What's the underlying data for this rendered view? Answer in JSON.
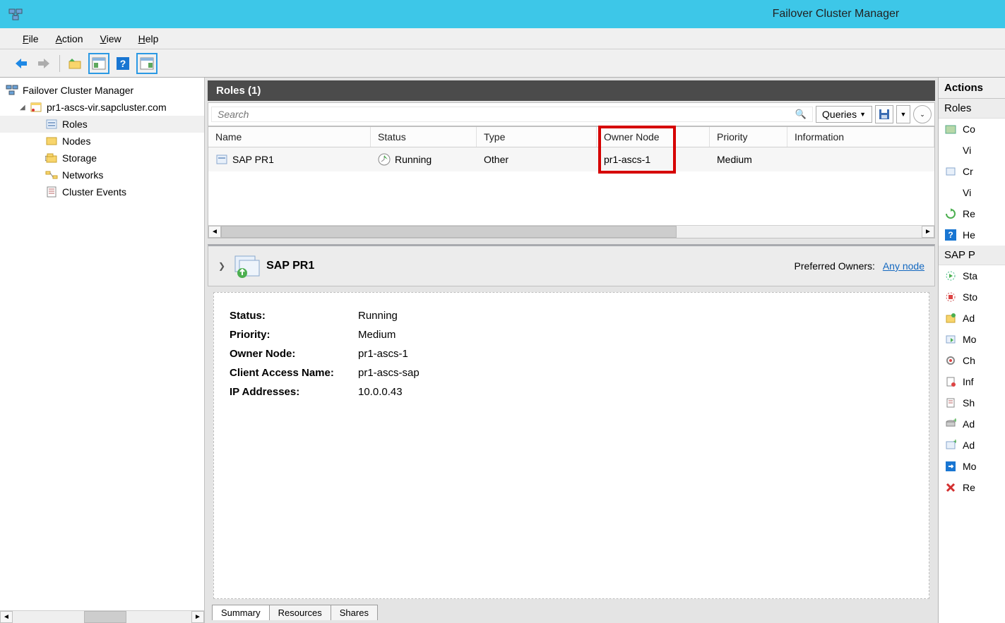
{
  "window": {
    "title": "Failover Cluster Manager"
  },
  "menu": {
    "file": "File",
    "action": "Action",
    "view": "View",
    "help": "Help"
  },
  "tree": {
    "root": "Failover Cluster Manager",
    "cluster": "pr1-ascs-vir.sapcluster.com",
    "roles": "Roles",
    "nodes": "Nodes",
    "storage": "Storage",
    "networks": "Networks",
    "events": "Cluster Events"
  },
  "roles_header": "Roles (1)",
  "search": {
    "placeholder": "Search",
    "queries": "Queries"
  },
  "columns": {
    "name": "Name",
    "status": "Status",
    "type": "Type",
    "owner": "Owner Node",
    "priority": "Priority",
    "info": "Information"
  },
  "row": {
    "name": "SAP PR1",
    "status": "Running",
    "type": "Other",
    "owner": "pr1-ascs-1",
    "priority": "Medium",
    "info": ""
  },
  "detail": {
    "name": "SAP PR1",
    "preferred_label": "Preferred Owners:",
    "preferred_link": "Any node",
    "status_label": "Status:",
    "status": "Running",
    "priority_label": "Priority:",
    "priority": "Medium",
    "owner_label": "Owner Node:",
    "owner": "pr1-ascs-1",
    "can_label": "Client Access Name:",
    "can": "pr1-ascs-sap",
    "ip_label": "IP Addresses:",
    "ip": "10.0.0.43"
  },
  "tabs": {
    "summary": "Summary",
    "resources": "Resources",
    "shares": "Shares"
  },
  "actions": {
    "title": "Actions",
    "sec1": "Roles",
    "sec2": "SAP P",
    "items1": [
      "Co",
      "Vi",
      "Cr",
      "Vi",
      "Re",
      "He"
    ],
    "items2": [
      "Sta",
      "Sto",
      "Ad",
      "Mo",
      "Ch",
      "Inf",
      "Sh",
      "Ad",
      "Ad",
      "Mo",
      "Re"
    ]
  }
}
